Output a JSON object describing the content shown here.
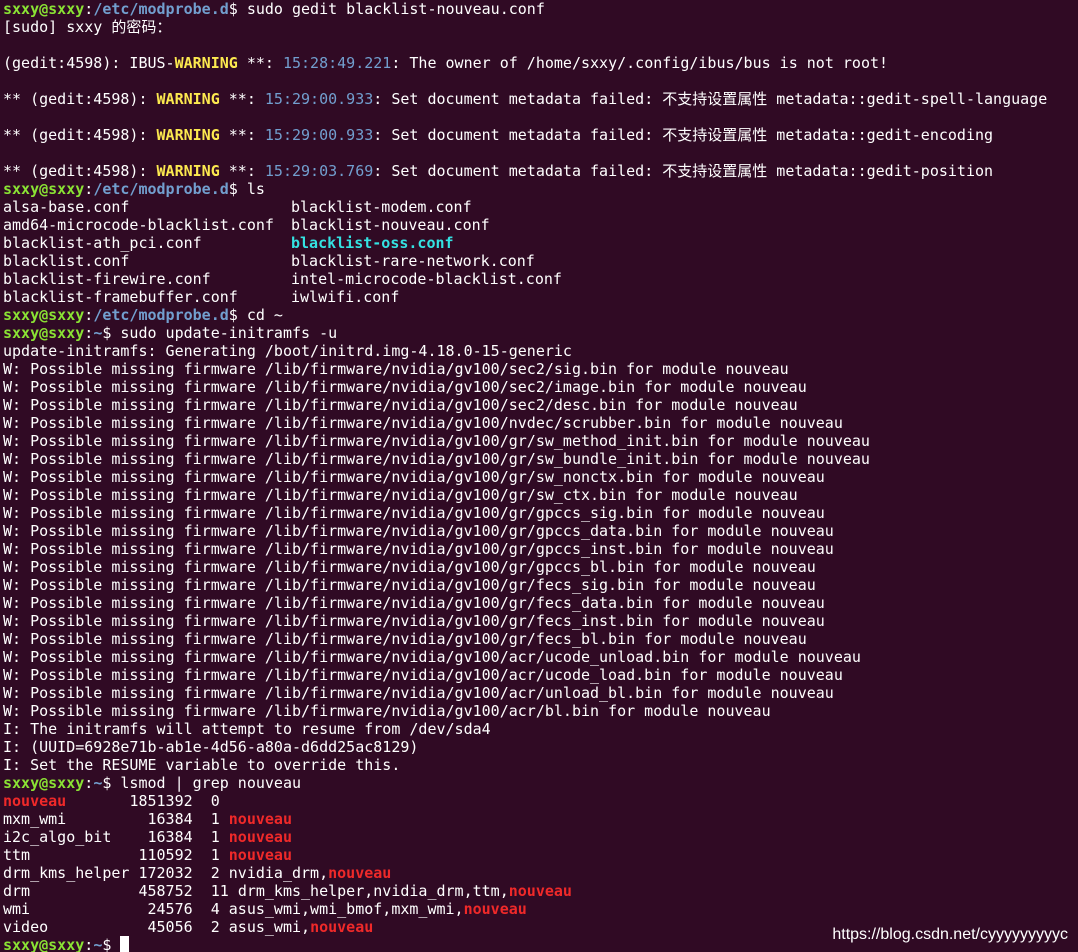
{
  "prompt": {
    "user": "sxxy@sxxy",
    "sep": ":",
    "path_modprobe": "/etc/modprobe.d",
    "path_home": "~",
    "dollar": "$ "
  },
  "commands": {
    "gedit": "sudo gedit blacklist-nouveau.conf",
    "ls": "ls",
    "cd": "cd ~",
    "update": "sudo update-initramfs -u",
    "lsmod": "lsmod | grep nouveau"
  },
  "sudo_prompt": "[sudo] sxxy 的密码：",
  "gedit_warnings": [
    {
      "prefix": "(gedit:4598): IBUS-",
      "level": "WARNING",
      "mid": " **: ",
      "time": "15:28:49.221",
      "msg": ": The owner of /home/sxxy/.config/ibus/bus is not root!"
    },
    {
      "prefix": "** (gedit:4598): ",
      "level": "WARNING",
      "mid": " **: ",
      "time": "15:29:00.933",
      "msg": ": Set document metadata failed: 不支持设置属性 metadata::gedit-spell-language"
    },
    {
      "prefix": "** (gedit:4598): ",
      "level": "WARNING",
      "mid": " **: ",
      "time": "15:29:00.933",
      "msg": ": Set document metadata failed: 不支持设置属性 metadata::gedit-encoding"
    },
    {
      "prefix": "** (gedit:4598): ",
      "level": "WARNING",
      "mid": " **: ",
      "time": "15:29:03.769",
      "msg": ": Set document metadata failed: 不支持设置属性 metadata::gedit-position"
    }
  ],
  "ls_rows": [
    {
      "a": "alsa-base.conf",
      "b": "blacklist-modem.conf",
      "b_hl": false
    },
    {
      "a": "amd64-microcode-blacklist.conf",
      "b": "blacklist-nouveau.conf",
      "b_hl": false
    },
    {
      "a": "blacklist-ath_pci.conf",
      "b": "blacklist-oss.conf",
      "b_hl": true
    },
    {
      "a": "blacklist.conf",
      "b": "blacklist-rare-network.conf",
      "b_hl": false
    },
    {
      "a": "blacklist-firewire.conf",
      "b": "intel-microcode-blacklist.conf",
      "b_hl": false
    },
    {
      "a": "blacklist-framebuffer.conf",
      "b": "iwlwifi.conf",
      "b_hl": false
    }
  ],
  "update_lines": [
    "update-initramfs: Generating /boot/initrd.img-4.18.0-15-generic",
    "W: Possible missing firmware /lib/firmware/nvidia/gv100/sec2/sig.bin for module nouveau",
    "W: Possible missing firmware /lib/firmware/nvidia/gv100/sec2/image.bin for module nouveau",
    "W: Possible missing firmware /lib/firmware/nvidia/gv100/sec2/desc.bin for module nouveau",
    "W: Possible missing firmware /lib/firmware/nvidia/gv100/nvdec/scrubber.bin for module nouveau",
    "W: Possible missing firmware /lib/firmware/nvidia/gv100/gr/sw_method_init.bin for module nouveau",
    "W: Possible missing firmware /lib/firmware/nvidia/gv100/gr/sw_bundle_init.bin for module nouveau",
    "W: Possible missing firmware /lib/firmware/nvidia/gv100/gr/sw_nonctx.bin for module nouveau",
    "W: Possible missing firmware /lib/firmware/nvidia/gv100/gr/sw_ctx.bin for module nouveau",
    "W: Possible missing firmware /lib/firmware/nvidia/gv100/gr/gpccs_sig.bin for module nouveau",
    "W: Possible missing firmware /lib/firmware/nvidia/gv100/gr/gpccs_data.bin for module nouveau",
    "W: Possible missing firmware /lib/firmware/nvidia/gv100/gr/gpccs_inst.bin for module nouveau",
    "W: Possible missing firmware /lib/firmware/nvidia/gv100/gr/gpccs_bl.bin for module nouveau",
    "W: Possible missing firmware /lib/firmware/nvidia/gv100/gr/fecs_sig.bin for module nouveau",
    "W: Possible missing firmware /lib/firmware/nvidia/gv100/gr/fecs_data.bin for module nouveau",
    "W: Possible missing firmware /lib/firmware/nvidia/gv100/gr/fecs_inst.bin for module nouveau",
    "W: Possible missing firmware /lib/firmware/nvidia/gv100/gr/fecs_bl.bin for module nouveau",
    "W: Possible missing firmware /lib/firmware/nvidia/gv100/acr/ucode_unload.bin for module nouveau",
    "W: Possible missing firmware /lib/firmware/nvidia/gv100/acr/ucode_load.bin for module nouveau",
    "W: Possible missing firmware /lib/firmware/nvidia/gv100/acr/unload_bl.bin for module nouveau",
    "W: Possible missing firmware /lib/firmware/nvidia/gv100/acr/bl.bin for module nouveau",
    "I: The initramfs will attempt to resume from /dev/sda4",
    "I: (UUID=6928e71b-ab1e-4d56-a80a-d6dd25ac8129)",
    "I: Set the RESUME variable to override this."
  ],
  "lsmod_rows": [
    {
      "mod": "nouveau",
      "mod_hl": true,
      "size": "1851392",
      "count": "0",
      "pre": "",
      "hl": "",
      "post": ""
    },
    {
      "mod": "mxm_wmi",
      "mod_hl": false,
      "size": "16384",
      "count": "1",
      "pre": "",
      "hl": "nouveau",
      "post": ""
    },
    {
      "mod": "i2c_algo_bit",
      "mod_hl": false,
      "size": "16384",
      "count": "1",
      "pre": "",
      "hl": "nouveau",
      "post": ""
    },
    {
      "mod": "ttm",
      "mod_hl": false,
      "size": "110592",
      "count": "1",
      "pre": "",
      "hl": "nouveau",
      "post": ""
    },
    {
      "mod": "drm_kms_helper",
      "mod_hl": false,
      "size": "172032",
      "count": "2",
      "pre": "nvidia_drm,",
      "hl": "nouveau",
      "post": ""
    },
    {
      "mod": "drm",
      "mod_hl": false,
      "size": "458752",
      "count": "11",
      "pre": "drm_kms_helper,nvidia_drm,ttm,",
      "hl": "nouveau",
      "post": ""
    },
    {
      "mod": "wmi",
      "mod_hl": false,
      "size": "24576",
      "count": "4",
      "pre": "asus_wmi,wmi_bmof,mxm_wmi,",
      "hl": "nouveau",
      "post": ""
    },
    {
      "mod": "video",
      "mod_hl": false,
      "size": "45056",
      "count": "2",
      "pre": "asus_wmi,",
      "hl": "nouveau",
      "post": ""
    }
  ],
  "watermark": "https://blog.csdn.net/cyyyyyyyyyc",
  "colors": {
    "background": "#300a24",
    "user": "#8ae234",
    "path": "#729fcf",
    "warning": "#fce94f",
    "highlight_red": "#ef2929",
    "highlight_cyan": "#34e2e2"
  }
}
